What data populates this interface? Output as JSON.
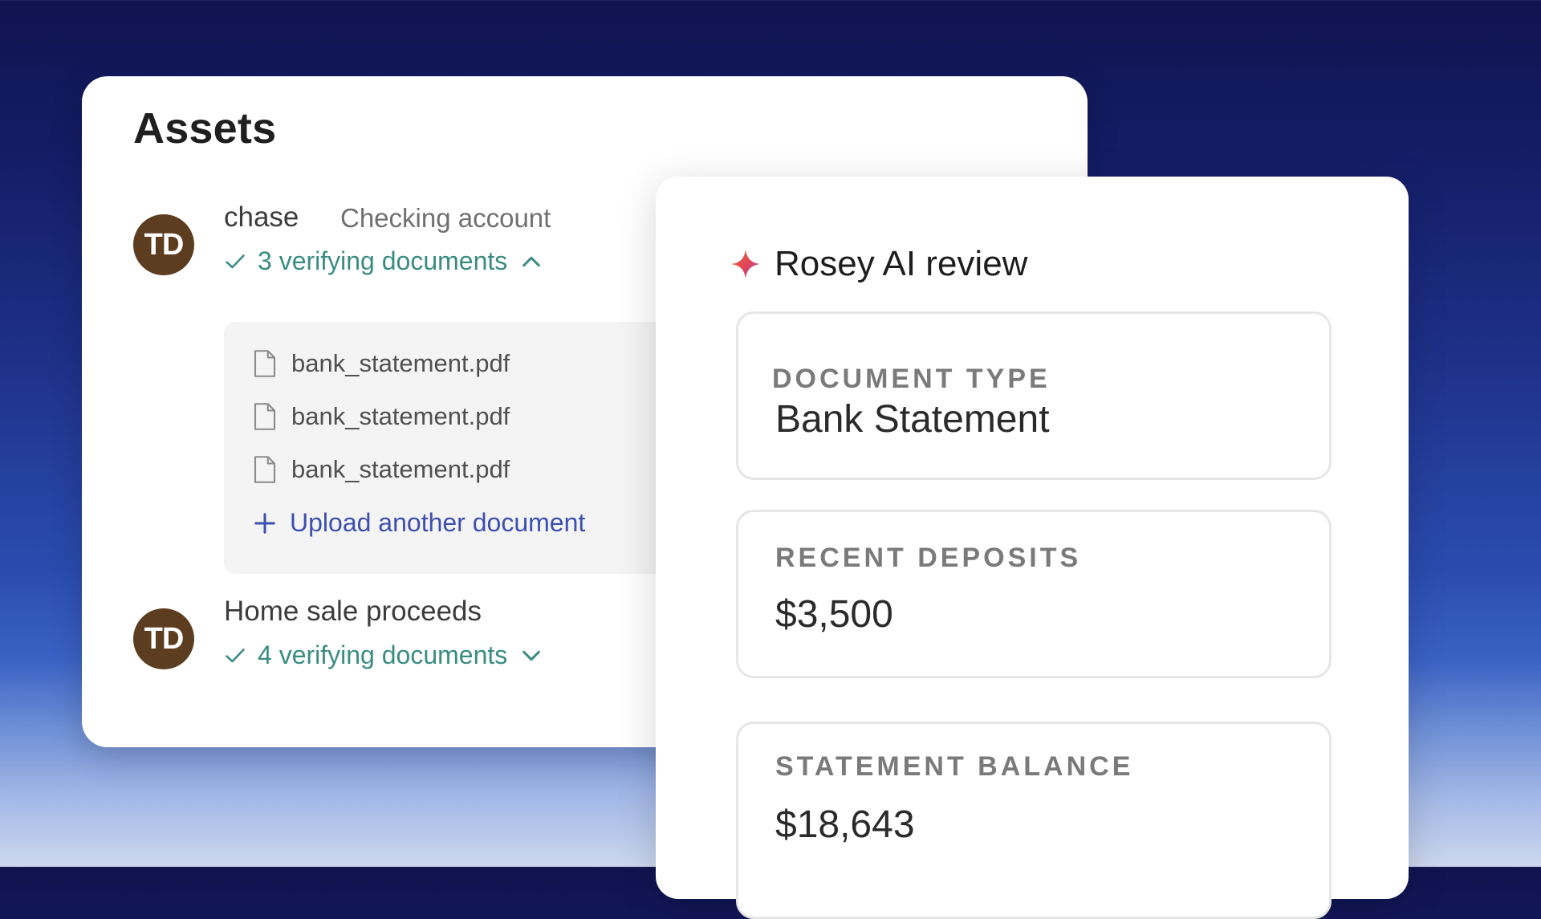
{
  "assets": {
    "title": "Assets",
    "accounts": [
      {
        "avatar_initials": "TD",
        "name": "chase",
        "type": "Checking account",
        "verify_text": "3 verifying documents",
        "expanded": true,
        "documents": [
          "bank_statement.pdf",
          "bank_statement.pdf",
          "bank_statement.pdf"
        ],
        "upload_label": "Upload another document"
      },
      {
        "avatar_initials": "TD",
        "name": "Home sale proceeds",
        "verify_text": "4 verifying documents",
        "expanded": false
      }
    ]
  },
  "review": {
    "title": "Rosey AI review",
    "icon": "sparkle-icon",
    "fields": [
      {
        "label": "DOCUMENT TYPE",
        "value": "Bank Statement"
      },
      {
        "label": "RECENT DEPOSITS",
        "value": "$3,500"
      },
      {
        "label": "STATEMENT BALANCE",
        "value": "$18,643"
      }
    ]
  },
  "colors": {
    "avatar_bg": "#5c3d1f",
    "verify_green": "#3a8c82",
    "link_blue": "#3d4fb0",
    "background_top": "#10134f",
    "background_bottom": "#cdd8ef"
  }
}
